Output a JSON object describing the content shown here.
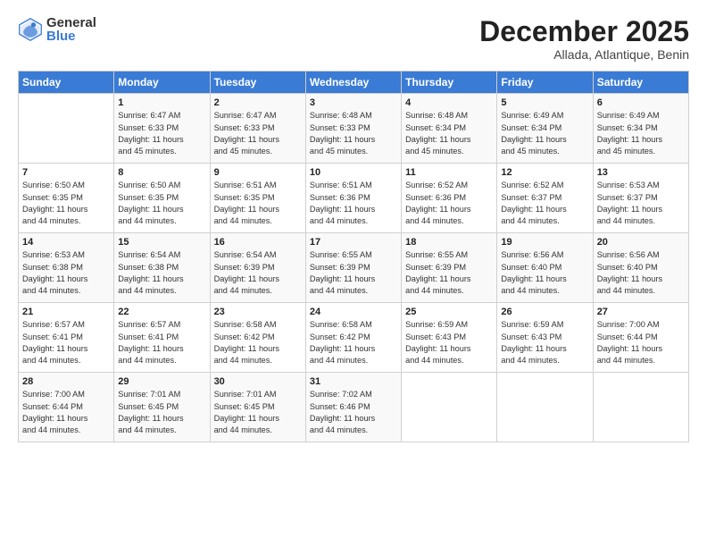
{
  "logo": {
    "general": "General",
    "blue": "Blue"
  },
  "title": "December 2025",
  "location": "Allada, Atlantique, Benin",
  "days_of_week": [
    "Sunday",
    "Monday",
    "Tuesday",
    "Wednesday",
    "Thursday",
    "Friday",
    "Saturday"
  ],
  "weeks": [
    [
      {
        "day": "",
        "sunrise": "",
        "sunset": "",
        "daylight": ""
      },
      {
        "day": "1",
        "sunrise": "Sunrise: 6:47 AM",
        "sunset": "Sunset: 6:33 PM",
        "daylight": "Daylight: 11 hours and 45 minutes."
      },
      {
        "day": "2",
        "sunrise": "Sunrise: 6:47 AM",
        "sunset": "Sunset: 6:33 PM",
        "daylight": "Daylight: 11 hours and 45 minutes."
      },
      {
        "day": "3",
        "sunrise": "Sunrise: 6:48 AM",
        "sunset": "Sunset: 6:33 PM",
        "daylight": "Daylight: 11 hours and 45 minutes."
      },
      {
        "day": "4",
        "sunrise": "Sunrise: 6:48 AM",
        "sunset": "Sunset: 6:34 PM",
        "daylight": "Daylight: 11 hours and 45 minutes."
      },
      {
        "day": "5",
        "sunrise": "Sunrise: 6:49 AM",
        "sunset": "Sunset: 6:34 PM",
        "daylight": "Daylight: 11 hours and 45 minutes."
      },
      {
        "day": "6",
        "sunrise": "Sunrise: 6:49 AM",
        "sunset": "Sunset: 6:34 PM",
        "daylight": "Daylight: 11 hours and 45 minutes."
      }
    ],
    [
      {
        "day": "7",
        "sunrise": "Sunrise: 6:50 AM",
        "sunset": "Sunset: 6:35 PM",
        "daylight": "Daylight: 11 hours and 44 minutes."
      },
      {
        "day": "8",
        "sunrise": "Sunrise: 6:50 AM",
        "sunset": "Sunset: 6:35 PM",
        "daylight": "Daylight: 11 hours and 44 minutes."
      },
      {
        "day": "9",
        "sunrise": "Sunrise: 6:51 AM",
        "sunset": "Sunset: 6:35 PM",
        "daylight": "Daylight: 11 hours and 44 minutes."
      },
      {
        "day": "10",
        "sunrise": "Sunrise: 6:51 AM",
        "sunset": "Sunset: 6:36 PM",
        "daylight": "Daylight: 11 hours and 44 minutes."
      },
      {
        "day": "11",
        "sunrise": "Sunrise: 6:52 AM",
        "sunset": "Sunset: 6:36 PM",
        "daylight": "Daylight: 11 hours and 44 minutes."
      },
      {
        "day": "12",
        "sunrise": "Sunrise: 6:52 AM",
        "sunset": "Sunset: 6:37 PM",
        "daylight": "Daylight: 11 hours and 44 minutes."
      },
      {
        "day": "13",
        "sunrise": "Sunrise: 6:53 AM",
        "sunset": "Sunset: 6:37 PM",
        "daylight": "Daylight: 11 hours and 44 minutes."
      }
    ],
    [
      {
        "day": "14",
        "sunrise": "Sunrise: 6:53 AM",
        "sunset": "Sunset: 6:38 PM",
        "daylight": "Daylight: 11 hours and 44 minutes."
      },
      {
        "day": "15",
        "sunrise": "Sunrise: 6:54 AM",
        "sunset": "Sunset: 6:38 PM",
        "daylight": "Daylight: 11 hours and 44 minutes."
      },
      {
        "day": "16",
        "sunrise": "Sunrise: 6:54 AM",
        "sunset": "Sunset: 6:39 PM",
        "daylight": "Daylight: 11 hours and 44 minutes."
      },
      {
        "day": "17",
        "sunrise": "Sunrise: 6:55 AM",
        "sunset": "Sunset: 6:39 PM",
        "daylight": "Daylight: 11 hours and 44 minutes."
      },
      {
        "day": "18",
        "sunrise": "Sunrise: 6:55 AM",
        "sunset": "Sunset: 6:39 PM",
        "daylight": "Daylight: 11 hours and 44 minutes."
      },
      {
        "day": "19",
        "sunrise": "Sunrise: 6:56 AM",
        "sunset": "Sunset: 6:40 PM",
        "daylight": "Daylight: 11 hours and 44 minutes."
      },
      {
        "day": "20",
        "sunrise": "Sunrise: 6:56 AM",
        "sunset": "Sunset: 6:40 PM",
        "daylight": "Daylight: 11 hours and 44 minutes."
      }
    ],
    [
      {
        "day": "21",
        "sunrise": "Sunrise: 6:57 AM",
        "sunset": "Sunset: 6:41 PM",
        "daylight": "Daylight: 11 hours and 44 minutes."
      },
      {
        "day": "22",
        "sunrise": "Sunrise: 6:57 AM",
        "sunset": "Sunset: 6:41 PM",
        "daylight": "Daylight: 11 hours and 44 minutes."
      },
      {
        "day": "23",
        "sunrise": "Sunrise: 6:58 AM",
        "sunset": "Sunset: 6:42 PM",
        "daylight": "Daylight: 11 hours and 44 minutes."
      },
      {
        "day": "24",
        "sunrise": "Sunrise: 6:58 AM",
        "sunset": "Sunset: 6:42 PM",
        "daylight": "Daylight: 11 hours and 44 minutes."
      },
      {
        "day": "25",
        "sunrise": "Sunrise: 6:59 AM",
        "sunset": "Sunset: 6:43 PM",
        "daylight": "Daylight: 11 hours and 44 minutes."
      },
      {
        "day": "26",
        "sunrise": "Sunrise: 6:59 AM",
        "sunset": "Sunset: 6:43 PM",
        "daylight": "Daylight: 11 hours and 44 minutes."
      },
      {
        "day": "27",
        "sunrise": "Sunrise: 7:00 AM",
        "sunset": "Sunset: 6:44 PM",
        "daylight": "Daylight: 11 hours and 44 minutes."
      }
    ],
    [
      {
        "day": "28",
        "sunrise": "Sunrise: 7:00 AM",
        "sunset": "Sunset: 6:44 PM",
        "daylight": "Daylight: 11 hours and 44 minutes."
      },
      {
        "day": "29",
        "sunrise": "Sunrise: 7:01 AM",
        "sunset": "Sunset: 6:45 PM",
        "daylight": "Daylight: 11 hours and 44 minutes."
      },
      {
        "day": "30",
        "sunrise": "Sunrise: 7:01 AM",
        "sunset": "Sunset: 6:45 PM",
        "daylight": "Daylight: 11 hours and 44 minutes."
      },
      {
        "day": "31",
        "sunrise": "Sunrise: 7:02 AM",
        "sunset": "Sunset: 6:46 PM",
        "daylight": "Daylight: 11 hours and 44 minutes."
      },
      {
        "day": "",
        "sunrise": "",
        "sunset": "",
        "daylight": ""
      },
      {
        "day": "",
        "sunrise": "",
        "sunset": "",
        "daylight": ""
      },
      {
        "day": "",
        "sunrise": "",
        "sunset": "",
        "daylight": ""
      }
    ]
  ]
}
